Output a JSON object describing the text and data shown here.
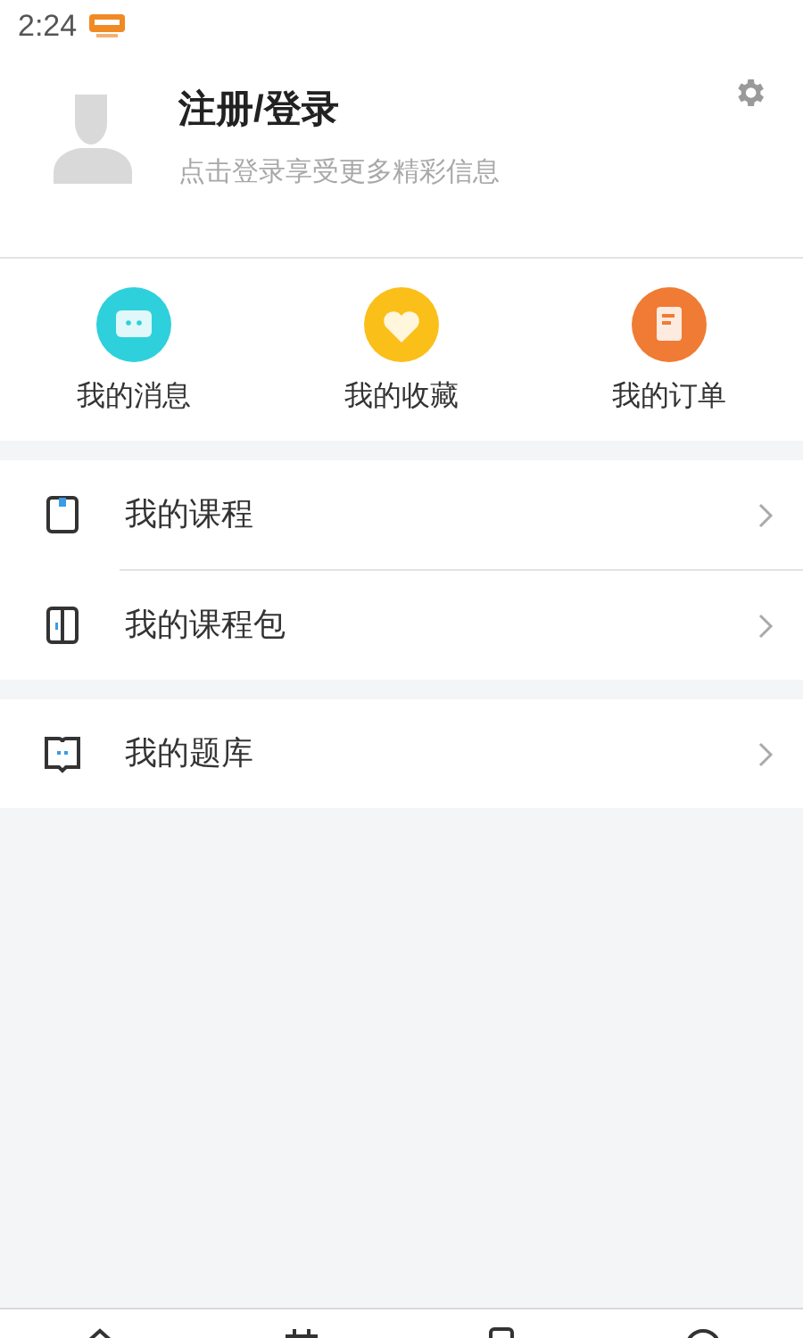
{
  "status_bar": {
    "time": "2:24"
  },
  "profile": {
    "title": "注册/登录",
    "subtitle": "点击登录享受更多精彩信息"
  },
  "shortcuts": [
    {
      "kind": "message",
      "label": "我的消息"
    },
    {
      "kind": "favorite",
      "label": "我的收藏"
    },
    {
      "kind": "order",
      "label": "我的订单"
    }
  ],
  "menu_groups": [
    [
      {
        "kind": "course",
        "label": "我的课程"
      },
      {
        "kind": "package",
        "label": "我的课程包"
      }
    ],
    [
      {
        "kind": "questions",
        "label": "我的题库"
      }
    ]
  ],
  "bottom_nav": [
    {
      "kind": "home"
    },
    {
      "kind": "calendar"
    },
    {
      "kind": "book"
    },
    {
      "kind": "profile"
    }
  ]
}
